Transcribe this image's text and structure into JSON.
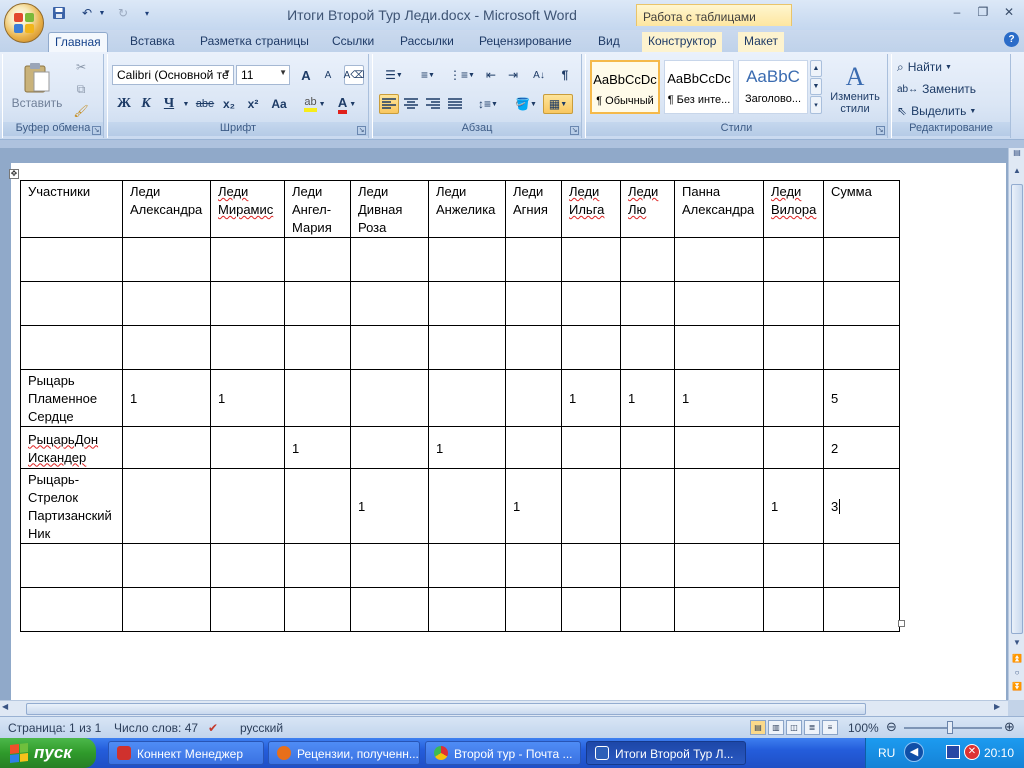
{
  "window": {
    "title": "Итоги Второй Тур Леди.docx - Microsoft Word",
    "context_tab_header": "Работа с таблицами",
    "controls": {
      "minimize": "–",
      "restore": "❐",
      "close": "✕"
    }
  },
  "qat": {
    "save_icon": "save-icon",
    "undo_icon": "undo-icon",
    "redo_icon": "redo-icon"
  },
  "tabs": [
    {
      "label": "Главная"
    },
    {
      "label": "Вставка"
    },
    {
      "label": "Разметка страницы"
    },
    {
      "label": "Ссылки"
    },
    {
      "label": "Рассылки"
    },
    {
      "label": "Рецензирование"
    },
    {
      "label": "Вид"
    },
    {
      "label": "Конструктор"
    },
    {
      "label": "Макет"
    }
  ],
  "ribbon": {
    "clipboard": {
      "label": "Буфер обмена",
      "paste_label": "Вставить"
    },
    "font": {
      "label": "Шрифт",
      "font_name": "Calibri (Основной те",
      "font_size": "11",
      "bold": "Ж",
      "italic": "К",
      "underline": "Ч",
      "strike": "abe",
      "subscript": "x₂",
      "superscript": "x²",
      "case": "Aa",
      "grow": "A",
      "shrink": "A"
    },
    "paragraph": {
      "label": "Абзац",
      "pilcrow": "¶"
    },
    "styles": {
      "label": "Стили",
      "items": [
        {
          "sample": "AaBbCcDc",
          "name": "¶ Обычный"
        },
        {
          "sample": "AaBbCcDc",
          "name": "¶ Без инте..."
        },
        {
          "sample": "AaBbC",
          "name": "Заголово..."
        }
      ],
      "change_styles": "Изменить стили"
    },
    "editing": {
      "label": "Редактирование",
      "find": "Найти",
      "replace": "Заменить",
      "select": "Выделить"
    }
  },
  "table": {
    "header": [
      "Участники",
      "Леди Александра",
      "Леди Мирамис",
      "Леди Ангел-Мария",
      "Леди Дивная Роза",
      "Леди Анжелика",
      "Леди Агния",
      "Леди Ильга",
      "Леди Лю",
      "Панна Александра",
      "Леди Вилора",
      "Сумма"
    ],
    "rows": [
      [
        "",
        "",
        "",
        "",
        "",
        "",
        "",
        "",
        "",
        "",
        "",
        ""
      ],
      [
        "",
        "",
        "",
        "",
        "",
        "",
        "",
        "",
        "",
        "",
        "",
        ""
      ],
      [
        "",
        "",
        "",
        "",
        "",
        "",
        "",
        "",
        "",
        "",
        "",
        ""
      ],
      [
        "Рыцарь Пламенное Сердце",
        "1",
        "1",
        "",
        "",
        "",
        "",
        "1",
        "1",
        "1",
        "",
        "5"
      ],
      [
        "РыцарьДон Искандер",
        "",
        "",
        "1",
        "",
        "1",
        "",
        "",
        "",
        "",
        "",
        "2"
      ],
      [
        "Рыцарь-Стрелок Партизанский Ник",
        "",
        "",
        "",
        "1",
        "",
        "1",
        "",
        "",
        "",
        "1",
        "3"
      ],
      [
        "",
        "",
        "",
        "",
        "",
        "",
        "",
        "",
        "",
        "",
        "",
        ""
      ],
      [
        "",
        "",
        "",
        "",
        "",
        "",
        "",
        "",
        "",
        "",
        "",
        ""
      ]
    ]
  },
  "status": {
    "page": "Страница: 1 из 1",
    "words": "Число слов: 47",
    "language": "русский",
    "zoom": "100%"
  },
  "taskbar": {
    "start": "пуск",
    "tasks": [
      {
        "label": "Коннект Менеджер",
        "color": "#d0312d"
      },
      {
        "label": "Рецензии, полученн...",
        "color": "#e76f1a"
      },
      {
        "label": "Второй тур - Почта ...",
        "color": "#3b9a3b"
      },
      {
        "label": "Итоги Второй Тур Л...",
        "color": "#2c5fb8"
      }
    ],
    "lang": "RU",
    "time": "20:10"
  }
}
